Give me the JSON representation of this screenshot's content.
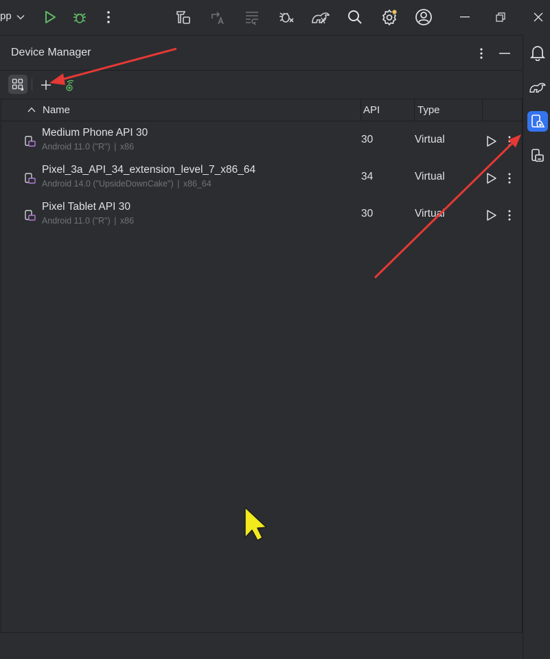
{
  "titlebar": {
    "app_label": "pp",
    "icons": [
      "chevron-down-icon",
      "run-icon",
      "debug-icon",
      "more-vertical-icon",
      "build-icon",
      "translate-icon",
      "format-icon",
      "bug-settings-icon",
      "gradle-icon",
      "search-icon",
      "settings-icon",
      "account-icon",
      "minimize-icon",
      "restore-icon",
      "close-icon"
    ],
    "colors": {
      "run": "#5fb865",
      "debug": "#5fb865",
      "settings_badge": "#e9c160"
    }
  },
  "panel": {
    "title": "Device Manager"
  },
  "table": {
    "columns": {
      "name": "Name",
      "api": "API",
      "type": "Type"
    },
    "rows": [
      {
        "name": "Medium Phone API 30",
        "os": "Android 11.0 (\"R\")",
        "abi": "x86",
        "api": "30",
        "type": "Virtual"
      },
      {
        "name": "Pixel_3a_API_34_extension_level_7_x86_64",
        "os": "Android 14.0 (\"UpsideDownCake\")",
        "abi": "x86_64",
        "api": "34",
        "type": "Virtual"
      },
      {
        "name": "Pixel Tablet API 30",
        "os": "Android 11.0 (\"R\")",
        "abi": "x86",
        "api": "30",
        "type": "Virtual"
      }
    ]
  },
  "right_strip": {
    "items": [
      "notifications-icon",
      "gradle-icon",
      "device-manager-icon",
      "running-devices-icon"
    ],
    "active": "device-manager-icon",
    "accent": "#3574f0"
  },
  "annotations": {
    "arrow_color": "#e53935",
    "cursor_color": "#f2ea1d"
  }
}
